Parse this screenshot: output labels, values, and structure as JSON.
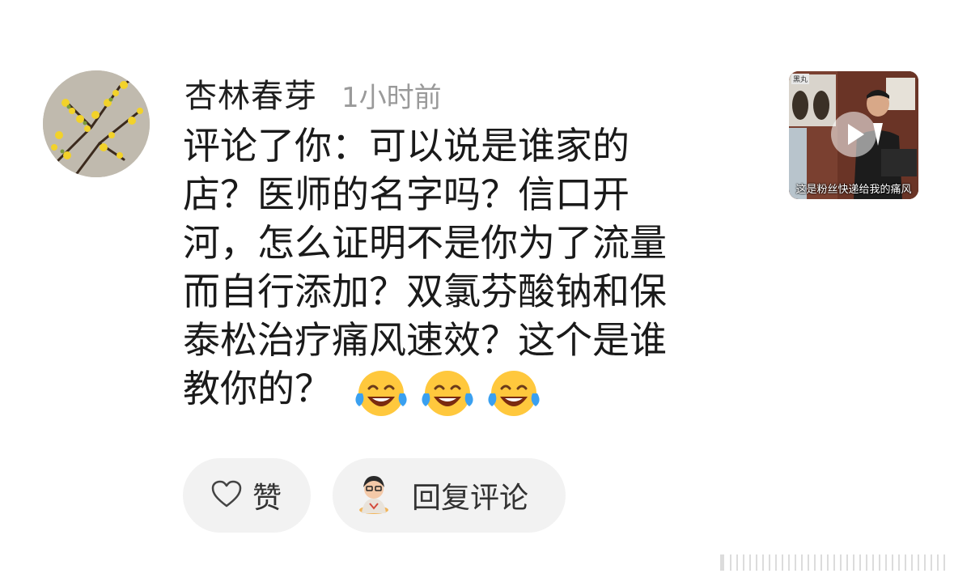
{
  "comment": {
    "username": "杏林春芽",
    "timestamp": "1小时前",
    "lines": [
      "评论了你：可以说是谁家的",
      "店？医师的名字吗？信口开",
      "河，怎么证明不是你为了流量",
      "而自行添加？双氯芬酸钠和保",
      "泰松治疗痛风速效？这个是谁",
      "教你的？"
    ],
    "emojis": [
      "laughing-crying-emoji",
      "laughing-crying-emoji",
      "laughing-crying-emoji"
    ]
  },
  "thumbnail": {
    "caption": "这是粉丝快递给我的痛风",
    "corner_label": "黑丸"
  },
  "actions": {
    "like_label": "赞",
    "reply_label": "回复评论"
  },
  "colors": {
    "timestamp": "#9a9a9a",
    "button_bg": "#f2f2f2",
    "text": "#1a1a1a"
  }
}
